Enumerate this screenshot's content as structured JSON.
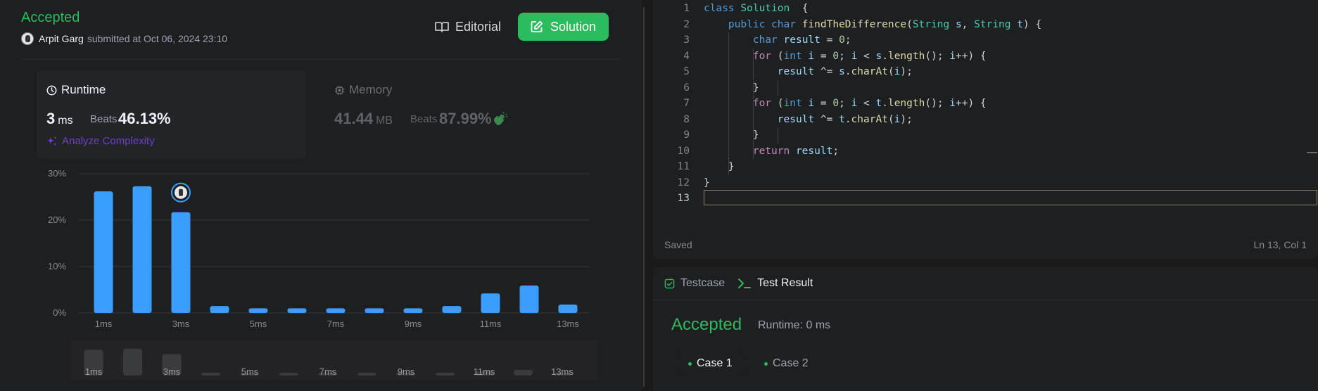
{
  "submission": {
    "status": "Accepted",
    "author": "Arpit Garg",
    "submitted_text": "submitted at Oct 06, 2024 23:10",
    "editorial_label": "Editorial",
    "solution_label": "Solution"
  },
  "runtime": {
    "label": "Runtime",
    "value": "3",
    "unit": "ms",
    "beats_label": "Beats",
    "beats_pct": "46.13%",
    "analyze_label": "Analyze Complexity"
  },
  "memory": {
    "label": "Memory",
    "value": "41.44",
    "unit": "MB",
    "beats_label": "Beats",
    "beats_pct": "87.99%"
  },
  "chart_data": {
    "type": "bar",
    "categories": [
      "1ms",
      "2ms",
      "3ms",
      "4ms",
      "5ms",
      "6ms",
      "7ms",
      "8ms",
      "9ms",
      "10ms",
      "11ms",
      "12ms",
      "13ms"
    ],
    "tick_labels": [
      "1ms",
      "3ms",
      "5ms",
      "7ms",
      "9ms",
      "11ms",
      "13ms"
    ],
    "values": [
      26.2,
      27.3,
      21.7,
      1.5,
      1.0,
      1.0,
      1.0,
      1.0,
      1.0,
      1.5,
      4.2,
      5.9,
      1.8
    ],
    "y_ticks": [
      "30%",
      "20%",
      "10%",
      "0%"
    ],
    "ylim": [
      0,
      30
    ],
    "highlight_index": 2,
    "color": "#3a9eff",
    "grid": true
  },
  "mini_chart": {
    "labels": [
      "1ms",
      "3ms",
      "5ms",
      "7ms",
      "9ms",
      "11ms",
      "13ms"
    ]
  },
  "editor": {
    "lines": [
      [
        [
          "kw",
          "class "
        ],
        [
          "ty",
          "Solution"
        ],
        [
          "",
          "  {"
        ]
      ],
      [
        [
          "",
          "    "
        ],
        [
          "kw",
          "public "
        ],
        [
          "kw",
          "char "
        ],
        [
          "fn",
          "findTheDifference"
        ],
        [
          "",
          "("
        ],
        [
          "ty",
          "String "
        ],
        [
          "vr",
          "s"
        ],
        [
          "",
          ", "
        ],
        [
          "ty",
          "String "
        ],
        [
          "vr",
          "t"
        ],
        [
          "",
          ") {"
        ]
      ],
      [
        [
          "",
          "        "
        ],
        [
          "kw",
          "char "
        ],
        [
          "vr",
          "result"
        ],
        [
          "",
          " = "
        ],
        [
          "nm",
          "0"
        ],
        [
          "",
          ";"
        ]
      ],
      [
        [
          "",
          "        "
        ],
        [
          "kw2",
          "for "
        ],
        [
          "",
          "("
        ],
        [
          "kw",
          "int "
        ],
        [
          "vr",
          "i"
        ],
        [
          "",
          " = "
        ],
        [
          "nm",
          "0"
        ],
        [
          "",
          "; "
        ],
        [
          "vr",
          "i"
        ],
        [
          "",
          " < "
        ],
        [
          "vr",
          "s"
        ],
        [
          "",
          "."
        ],
        [
          "fn",
          "length"
        ],
        [
          "",
          "(); "
        ],
        [
          "vr",
          "i"
        ],
        [
          "",
          "++) {"
        ]
      ],
      [
        [
          "",
          "            "
        ],
        [
          "vr",
          "result"
        ],
        [
          "",
          " ^= "
        ],
        [
          "vr",
          "s"
        ],
        [
          "",
          "."
        ],
        [
          "fn",
          "charAt"
        ],
        [
          "",
          "("
        ],
        [
          "vr",
          "i"
        ],
        [
          "",
          ");"
        ]
      ],
      [
        [
          "",
          "        }"
        ]
      ],
      [
        [
          "",
          "        "
        ],
        [
          "kw2",
          "for "
        ],
        [
          "",
          "("
        ],
        [
          "kw",
          "int "
        ],
        [
          "vr",
          "i"
        ],
        [
          "",
          " = "
        ],
        [
          "nm",
          "0"
        ],
        [
          "",
          "; "
        ],
        [
          "vr",
          "i"
        ],
        [
          "",
          " < "
        ],
        [
          "vr",
          "t"
        ],
        [
          "",
          "."
        ],
        [
          "fn",
          "length"
        ],
        [
          "",
          "(); "
        ],
        [
          "vr",
          "i"
        ],
        [
          "",
          "++) {"
        ]
      ],
      [
        [
          "",
          "            "
        ],
        [
          "vr",
          "result"
        ],
        [
          "",
          " ^= "
        ],
        [
          "vr",
          "t"
        ],
        [
          "",
          "."
        ],
        [
          "fn",
          "charAt"
        ],
        [
          "",
          "("
        ],
        [
          "vr",
          "i"
        ],
        [
          "",
          ");"
        ]
      ],
      [
        [
          "",
          "        }"
        ]
      ],
      [
        [
          "",
          "        "
        ],
        [
          "kw2",
          "return "
        ],
        [
          "vr",
          "result"
        ],
        [
          "",
          ";"
        ]
      ],
      [
        [
          "",
          "    }"
        ]
      ],
      [
        [
          "",
          "}"
        ]
      ],
      [
        [
          "",
          ""
        ]
      ]
    ],
    "line_numbers": [
      "1",
      "2",
      "3",
      "4",
      "5",
      "6",
      "7",
      "8",
      "9",
      "10",
      "11",
      "12",
      "13"
    ],
    "status": "Saved",
    "cursor": "Ln 13, Col 1"
  },
  "result": {
    "tab_testcase": "Testcase",
    "tab_result": "Test Result",
    "status": "Accepted",
    "runtime": "Runtime: 0 ms",
    "case1": "Case 1",
    "case2": "Case 2"
  }
}
